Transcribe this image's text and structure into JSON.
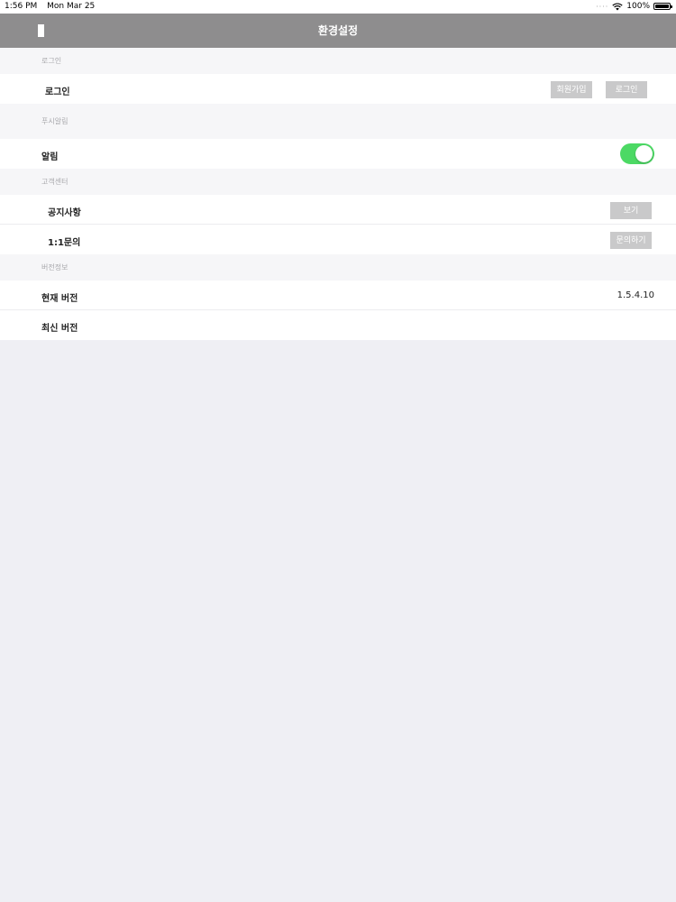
{
  "status_bar": {
    "time": "1:56 PM",
    "date": "Mon Mar 25",
    "battery": "100%"
  },
  "nav": {
    "title": "환경설정",
    "back_icon": "back-icon"
  },
  "sections": {
    "login": {
      "header": "로그인",
      "row_label": "로그인",
      "signup_button": "회원가입",
      "login_button": "로그인"
    },
    "push": {
      "header": "푸시알림",
      "row_label": "알림",
      "toggle_on": true
    },
    "support": {
      "header": "고객센터",
      "notice_label": "공지사항",
      "notice_button": "보기",
      "inquiry_label": "1:1문의",
      "inquiry_button": "문의하기"
    },
    "version": {
      "header": "버전정보",
      "current_label": "현재 버전",
      "current_value": "1.5.4.10",
      "latest_label": "최신 버전"
    }
  },
  "colors": {
    "nav_bg": "#8e8d8e",
    "toggle_on": "#4cd964",
    "button_bg": "#c9c9ca",
    "page_bg": "#efeff4"
  }
}
